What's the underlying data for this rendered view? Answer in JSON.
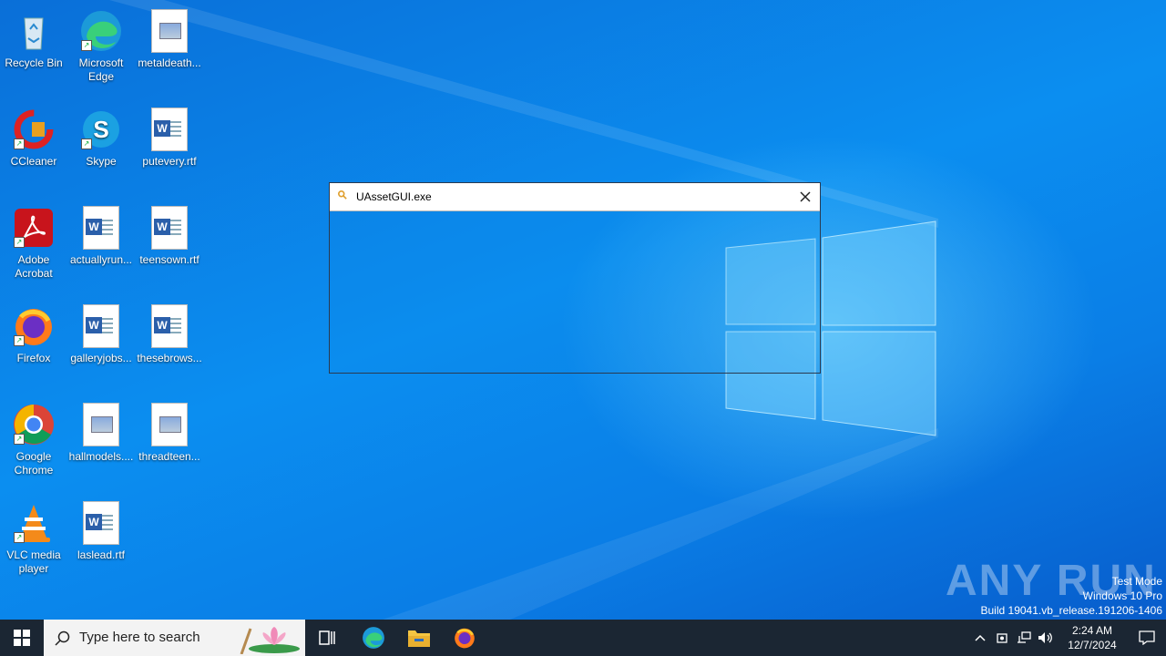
{
  "desktop": {
    "icons": [
      {
        "label": "Recycle Bin",
        "icon": "recycle-bin-icon"
      },
      {
        "label": "Microsoft Edge",
        "icon": "edge-icon"
      },
      {
        "label": "metaldeath...",
        "icon": "image-file-icon"
      },
      {
        "label": "CCleaner",
        "icon": "ccleaner-icon"
      },
      {
        "label": "Skype",
        "icon": "skype-icon"
      },
      {
        "label": "putevery.rtf",
        "icon": "word-document-icon"
      },
      {
        "label": "Adobe Acrobat",
        "icon": "acrobat-icon"
      },
      {
        "label": "actuallyrun...",
        "icon": "word-document-icon"
      },
      {
        "label": "teensown.rtf",
        "icon": "word-document-icon"
      },
      {
        "label": "Firefox",
        "icon": "firefox-icon"
      },
      {
        "label": "galleryjobs...",
        "icon": "word-document-icon"
      },
      {
        "label": "thesebrows...",
        "icon": "word-document-icon"
      },
      {
        "label": "Google Chrome",
        "icon": "chrome-icon"
      },
      {
        "label": "hallmodels....",
        "icon": "image-file-icon"
      },
      {
        "label": "threadteen...",
        "icon": "image-file-icon"
      },
      {
        "label": "VLC media player",
        "icon": "vlc-icon"
      },
      {
        "label": "laslead.rtf",
        "icon": "word-document-icon"
      }
    ]
  },
  "search_popup": {
    "query": "UAssetGUI.exe"
  },
  "watermark": {
    "brand": "ANY RUN",
    "mode": "Test Mode",
    "edition": "Windows 10 Pro",
    "build": "Build 19041.vb_release.191206-1406"
  },
  "taskbar": {
    "search_placeholder": "Type here to search",
    "clock_time": "2:24 AM",
    "clock_date": "12/7/2024"
  },
  "colors": {
    "taskbar": "#1b2633",
    "desktop_accent": "#0b8ef0"
  }
}
